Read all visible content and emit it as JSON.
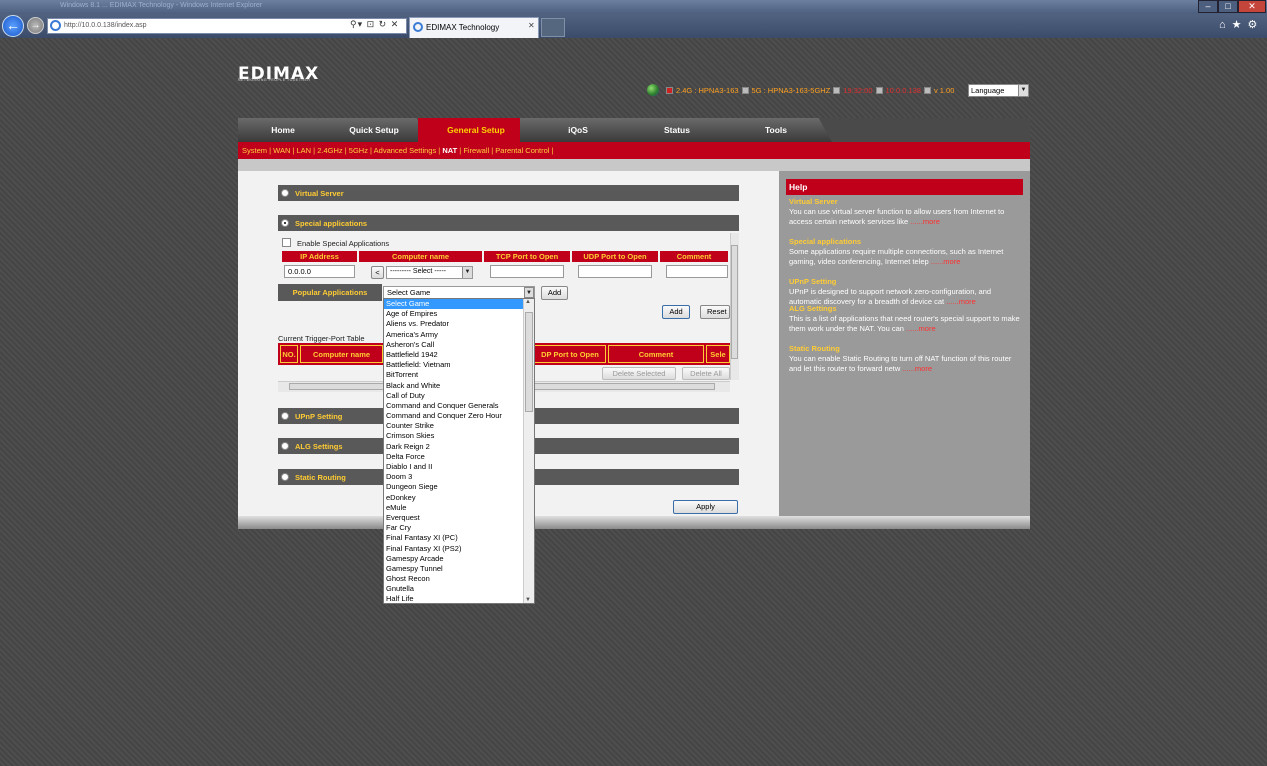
{
  "browser": {
    "window_title": "Windows 8.1 ... EDIMAX Technology - Windows Internet Explorer",
    "address": "http://10.0.0.138/index.asp",
    "tab_title": "EDIMAX Technology"
  },
  "brand": {
    "logo": "EDIMAX",
    "tagline": "NETWORKING PEOPLE TOGETHER"
  },
  "status": {
    "b24": "2.4G : HPNA3-163",
    "b5": "5G : HPNA3-163-5GHZ",
    "time": "19:32:00",
    "ip": "10.0.0.138",
    "version": "v 1.00",
    "language": "Language"
  },
  "menu": [
    "Home",
    "Quick Setup",
    "General Setup",
    "iQoS",
    "Status",
    "Tools"
  ],
  "submenu": [
    "System",
    "WAN",
    "LAN",
    "2.4GHz",
    "5GHz",
    "Advanced Settings",
    "NAT",
    "Firewall",
    "Parental Control"
  ],
  "sections": {
    "virtual_server": "Virtual Server",
    "special_apps": "Special applications",
    "upnp": "UPnP Setting",
    "alg": "ALG Settings",
    "static_routing": "Static Routing"
  },
  "special": {
    "enable_label": "Enable Special Applications",
    "headers": [
      "IP Address",
      "Computer name",
      "TCP Port to Open",
      "UDP Port to Open",
      "Comment"
    ],
    "ip_value": "0.0.0.0",
    "arrow_btn": "<",
    "computer_select": "--------- Select -----",
    "popular_label": "Popular Applications",
    "game_select": "Select Game",
    "add_small": "Add",
    "add": "Add",
    "reset": "Reset",
    "table_title": "Current Trigger-Port Table",
    "table_headers": [
      "NO.",
      "Computer name",
      "DP Port to Open",
      "Comment",
      "Sele"
    ],
    "delete_selected": "Delete Selected",
    "delete_all": "Delete All"
  },
  "apply": "Apply",
  "games": [
    "Select Game",
    "Age of Empires",
    "Aliens vs. Predator",
    "America's Army",
    "Asheron's Call",
    "Battlefield 1942",
    "Battlefield: Vietnam",
    "BitTorrent",
    "Black and White",
    "Call of Duty",
    "Command and Conquer Generals",
    "Command and Conquer Zero Hour",
    "Counter Strike",
    "Crimson Skies",
    "Dark Reign 2",
    "Delta Force",
    "Diablo I and II",
    "Doom 3",
    "Dungeon Siege",
    "eDonkey",
    "eMule",
    "Everquest",
    "Far Cry",
    "Final Fantasy XI (PC)",
    "Final Fantasy XI (PS2)",
    "Gamespy Arcade",
    "Gamespy Tunnel",
    "Ghost Recon",
    "Gnutella",
    "Half Life"
  ],
  "help": {
    "title": "Help",
    "items": [
      {
        "title": "Virtual Server",
        "body": "You can use virtual server function to allow users from Internet to access certain network services like",
        "more": "......more"
      },
      {
        "title": "Special applications",
        "body": "Some applications require multiple connections, such as Internet gaming, video conferencing, Internet telep",
        "more": "......more"
      },
      {
        "title": "UPnP Setting",
        "body": "UPnP is designed to support network zero-configuration, and automatic discovery for a breadth of device cat",
        "more": "......more"
      },
      {
        "title": "ALG Settings",
        "body": "This is a list of applications that need router's special support to make them work under the NAT. You can",
        "more": "......more"
      },
      {
        "title": "Static Routing",
        "body": "You can enable Static Routing to turn off NAT function of this router and let this router to forward netw",
        "more": "......more"
      }
    ]
  }
}
